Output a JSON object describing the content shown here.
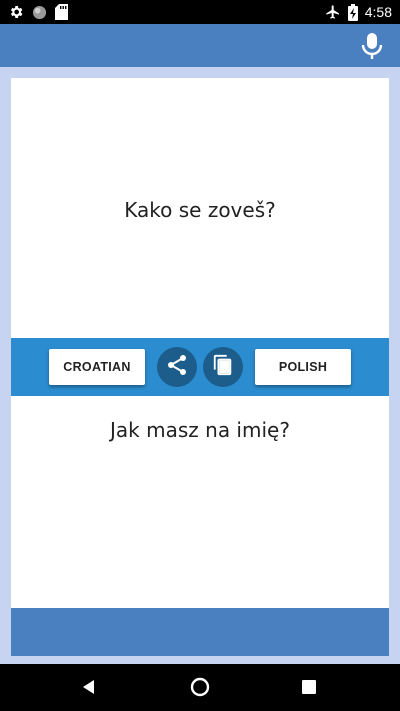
{
  "status_bar": {
    "time": "4:58",
    "icons": [
      "settings-icon",
      "circle-notification-icon",
      "sd-card-icon",
      "airplane-mode-icon",
      "battery-charging-icon"
    ]
  },
  "app_bar": {
    "action_icon": "mic-icon"
  },
  "translation": {
    "source_text": "Kako se zoveš?",
    "target_text": "Jak masz na imię?"
  },
  "toolbar": {
    "source_language": "CROATIAN",
    "target_language": "POLISH",
    "share_icon": "share-icon",
    "copy_icon": "copy-icon"
  },
  "nav_bar": {
    "icons": [
      "back-icon",
      "home-icon",
      "recents-icon"
    ]
  },
  "colors": {
    "app_bar": "#4a7fc0",
    "background": "#c6d4f1",
    "toolbar": "#2b8ccf",
    "round_button": "#1c5d8c"
  }
}
